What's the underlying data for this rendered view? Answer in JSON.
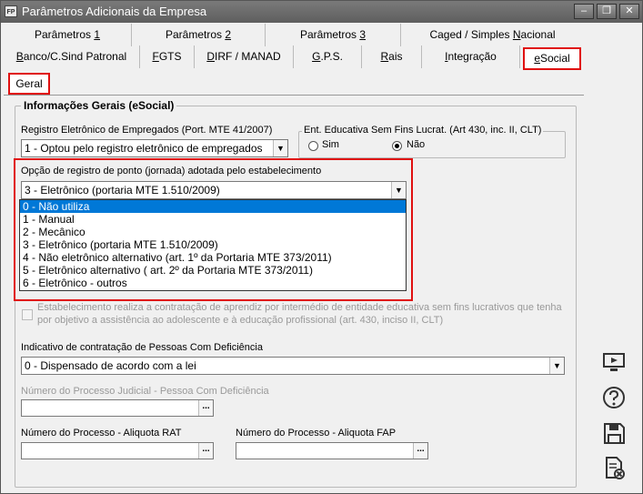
{
  "window": {
    "app_icon": "FP",
    "title": "Parâmetros Adicionais da Empresa",
    "minimize": "‒",
    "maximize": "❐",
    "close": "✕"
  },
  "tabs_row1": [
    {
      "pre": "Parâmetros ",
      "key": "1",
      "post": ""
    },
    {
      "pre": "Parâmetros ",
      "key": "2",
      "post": ""
    },
    {
      "pre": "Parâmetros ",
      "key": "3",
      "post": ""
    },
    {
      "pre": "Caged / Simples ",
      "key": "N",
      "post": "acional"
    }
  ],
  "tabs_row2": [
    {
      "pre": "",
      "key": "B",
      "post": "anco/C.Sind Patronal"
    },
    {
      "pre": "",
      "key": "F",
      "post": "GTS"
    },
    {
      "pre": "",
      "key": "D",
      "post": "IRF / MANAD"
    },
    {
      "pre": "",
      "key": "G",
      "post": ".P.S."
    },
    {
      "pre": "",
      "key": "R",
      "post": "ais"
    },
    {
      "pre": "",
      "key": "I",
      "post": "ntegração"
    },
    {
      "pre": "",
      "key": "e",
      "post": "Social"
    }
  ],
  "subtab": {
    "label": "Geral"
  },
  "group": {
    "title": "Informações Gerais (eSocial)"
  },
  "registro": {
    "label": "Registro Eletrônico de Empregados (Port. MTE 41/2007)",
    "value": "1 - Optou pelo registro eletrônico de empregados"
  },
  "entidade": {
    "title": "Ent. Educativa Sem Fins Lucrat. (Art 430, inc. II, CLT)",
    "sim": "Sim",
    "nao": "Não"
  },
  "ponto": {
    "label": "Opção de registro de ponto (jornada) adotada pelo estabelecimento",
    "value": "3 - Eletrônico (portaria MTE 1.510/2009)",
    "options": [
      "0 - Não utiliza",
      "1 - Manual",
      "2 - Mecânico",
      "3 - Eletrônico (portaria MTE 1.510/2009)",
      "4 - Não eletrônico alternativo (art. 1º da Portaria MTE 373/2011)",
      "5 - Eletrônico alternativo ( art. 2º da Portaria MTE 373/2011)",
      "6 - Eletrônico - outros"
    ],
    "highlighted_index": 0
  },
  "aprendiz": {
    "line1": "Estabelecimento realiza a contratação de aprendiz por intermédio de entidade educativa sem fins lucrativos que tenha",
    "line2": "por objetivo a assistência ao adolescente e à educação profissional (art. 430, inciso II, CLT)"
  },
  "pcd": {
    "label": "Indicativo de contratação de Pessoas Com Deficiência",
    "value": "0 - Dispensado de acordo com a lei"
  },
  "processo_pcd": {
    "label": "Número do Processo Judicial - Pessoa Com Deficiência"
  },
  "processo_rat": {
    "label": "Número do Processo - Aliquota RAT"
  },
  "processo_fap": {
    "label": "Número do Processo - Aliquota FAP"
  },
  "ellipsis": "...",
  "sidebar_icons": [
    "monitor-icon",
    "help-icon",
    "save-icon",
    "cancel-document-icon"
  ],
  "colors": {
    "highlight": "#e01010",
    "selection": "#0078d7"
  }
}
